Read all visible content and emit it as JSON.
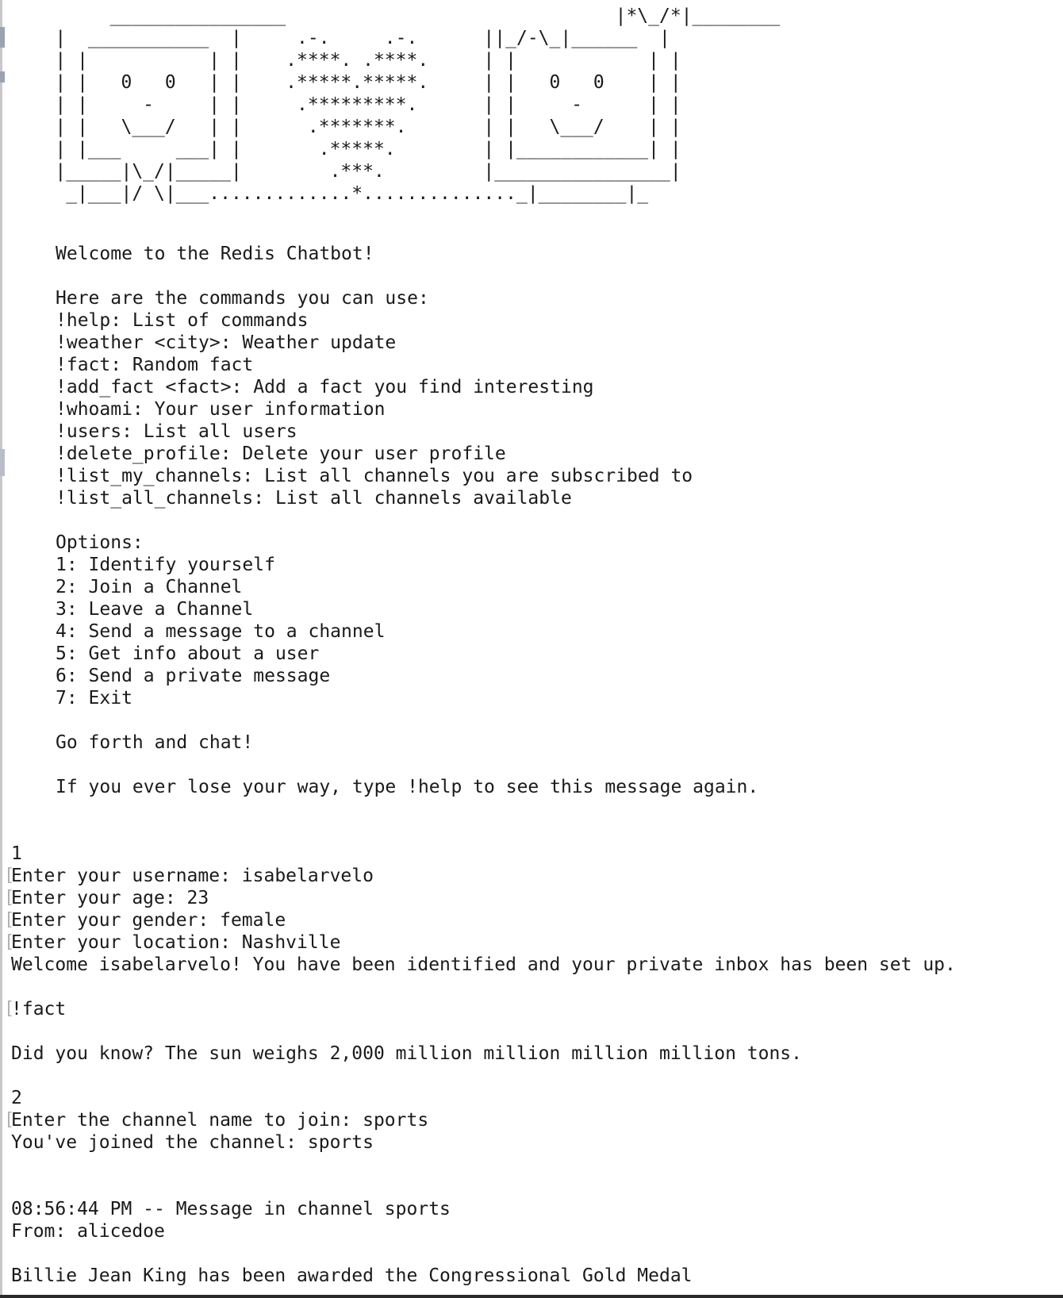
{
  "ascii_art": [
    "         ________________                              |*\\_/*|________",
    "    |  ___________  |     .-.     .-.      ||_/-\\_|______  |",
    "    | |           | |    .****. .****.     | |            | |",
    "    | |   0   0   | |    .*****.*****.     | |   0   0    | |",
    "    | |     -     | |     .*********.      | |     -      | |",
    "    | |   \\___/   | |      .*******.       | |   \\___/    | |",
    "    | |___     ___| |       .*****.        | |____________| |",
    "    |_____|\\_/|_____|        .***.         |________________|",
    "     _|___|/ \\|___.............*.............._|________|_"
  ],
  "welcome": {
    "title": "Welcome to the Redis Chatbot!",
    "commands_header": "Here are the commands you can use:",
    "commands": [
      "!help: List of commands",
      "!weather <city>: Weather update",
      "!fact: Random fact",
      "!add_fact <fact>: Add a fact you find interesting",
      "!whoami: Your user information",
      "!users: List all users",
      "!delete_profile: Delete your user profile",
      "!list_my_channels: List all channels you are subscribed to",
      "!list_all_channels: List all channels available"
    ],
    "options_header": "Options:",
    "options": [
      "1: Identify yourself",
      "2: Join a Channel",
      "3: Leave a Channel",
      "4: Send a message to a channel",
      "5: Get info about a user",
      "6: Send a private message",
      "7: Exit"
    ],
    "go_forth": "Go forth and chat!",
    "help_hint": "If you ever lose your way, type !help to see this message again."
  },
  "session": {
    "identify_choice": "1",
    "username_prompt": "Enter your username: isabelarvelo",
    "age_prompt": "Enter your age: 23",
    "gender_prompt": "Enter your gender: female",
    "location_prompt": "Enter your location: Nashville",
    "identified_msg": "Welcome isabelarvelo! You have been identified and your private inbox has been set up.",
    "fact_cmd": "!fact",
    "fact_result": "Did you know? The sun weighs 2,000 million million million million tons.",
    "join_choice": "2",
    "join_prompt": "Enter the channel name to join: sports",
    "joined_msg": "You've joined the channel: sports",
    "message_header": "08:56:44 PM -- Message in channel sports",
    "message_from": "From: alicedoe",
    "message_body": "Billie Jean King has been awarded the Congressional Gold Medal"
  }
}
